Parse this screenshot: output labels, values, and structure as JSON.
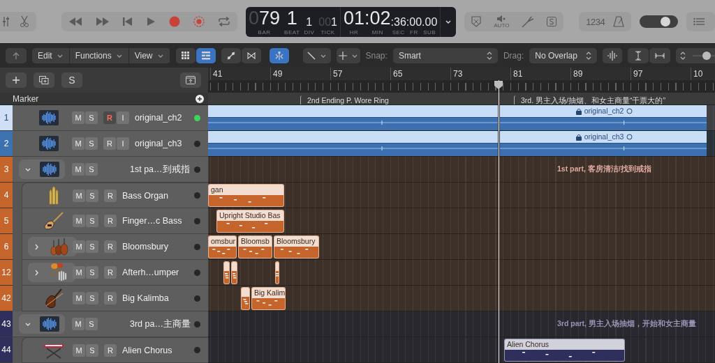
{
  "top_bar": {
    "lcd": {
      "position": [
        {
          "dim": "0",
          "value": "79",
          "label": "BAR",
          "kind": "large"
        },
        {
          "value": "1",
          "label": "BEAT",
          "kind": "large"
        },
        {
          "value": "1",
          "label": "DIV",
          "kind": "small"
        },
        {
          "dim": "00",
          "value": "1",
          "label": "TICK",
          "kind": "small"
        }
      ],
      "time": [
        {
          "value": "01",
          "label": "HR",
          "kind": "large"
        },
        {
          "value": ":02",
          "label": "MIN",
          "kind": "large"
        },
        {
          "value": ":36",
          "label": "SEC",
          "kind": "small"
        },
        {
          "value": ":00",
          "label": "FR",
          "kind": "small"
        },
        {
          "value": ".00",
          "label": "SUB",
          "kind": "small"
        }
      ]
    },
    "auto_label": "AUTO",
    "count_in": "1234",
    "volume": {
      "level": 0.68
    }
  },
  "toolbar": {
    "menus": [
      "Edit",
      "Functions",
      "View"
    ],
    "view_buttons": [
      {
        "selected": false
      },
      {
        "selected": true
      }
    ],
    "tool_buttons": [
      {
        "selected": false
      },
      {
        "selected": false
      },
      {
        "selected": true
      }
    ],
    "snap": {
      "label": "Snap:",
      "value": "Smart"
    },
    "drag": {
      "label": "Drag:",
      "value": "No Overlap"
    },
    "zoom": {
      "level": 0.55
    }
  },
  "track_header": {
    "solo_label": "S",
    "marker_label": "Marker"
  },
  "ruler": {
    "bars": [
      "41",
      "49",
      "57",
      "65",
      "73",
      "81",
      "89",
      "97",
      "10"
    ]
  },
  "markers": [
    {
      "label": "2nd Ending P. Wore Ring"
    },
    {
      "label": "3rd. 男主入场/抽烟、和女主商量“干票大的”"
    }
  ],
  "tracks": [
    {
      "number": "1",
      "name": "original_ch2",
      "kind": "audio",
      "color": "#cfe0f6",
      "buttons": [
        "M",
        "S",
        "R",
        "I"
      ],
      "record_armed": true,
      "active": true,
      "regions": [
        {
          "kind": "audio"
        },
        {
          "kind": "audio",
          "label": "original_ch2"
        }
      ]
    },
    {
      "number": "2",
      "name": "original_ch3",
      "kind": "audio",
      "color": "#3d72b0",
      "buttons": [
        "M",
        "S",
        "R",
        "I"
      ],
      "record_armed": false,
      "active": false,
      "regions": [
        {
          "kind": "audio"
        },
        {
          "kind": "audio",
          "label": "original_ch3"
        }
      ]
    },
    {
      "number": "3",
      "name": "1st pa…到戒指",
      "kind": "folder",
      "color": "#c6652b",
      "buttons": [
        "M",
        "S"
      ],
      "active": false,
      "expanded": true,
      "summary": "1st part, 客房清洁/找到戒指",
      "children": [
        {
          "number": "4",
          "name": "Bass Organ",
          "kind": "instrument",
          "color": "#c6652b",
          "buttons": [
            "M",
            "S",
            "R"
          ],
          "record_armed": false,
          "active": false,
          "regions": [
            {
              "kind": "midi",
              "label": "gan"
            }
          ]
        },
        {
          "number": "5",
          "name": "Finger…c Bass",
          "kind": "instrument",
          "color": "#c6652b",
          "buttons": [
            "M",
            "S",
            "R"
          ],
          "record_armed": false,
          "active": false,
          "regions": [
            {
              "kind": "midi",
              "label": "Upright Studio Bas"
            }
          ]
        },
        {
          "number": "6",
          "name": "Bloomsbury",
          "kind": "instrument",
          "color": "#c6652b",
          "buttons": [
            "M",
            "S",
            "R"
          ],
          "record_armed": false,
          "active": false,
          "expanded": false,
          "regions": [
            {
              "kind": "midi",
              "label": "omsbur"
            },
            {
              "kind": "midi",
              "label": "Bloomsb"
            },
            {
              "kind": "midi",
              "label": "Bloomsbury"
            }
          ]
        },
        {
          "number": "12",
          "name": "Afterh…umper",
          "kind": "instrument",
          "color": "#c6652b",
          "buttons": [
            "M",
            "S",
            "R"
          ],
          "record_armed": false,
          "active": false,
          "expanded": false,
          "regions": [
            {
              "kind": "midi"
            },
            {
              "kind": "midi"
            },
            {
              "kind": "midi"
            }
          ]
        },
        {
          "number": "42",
          "name": "Big Kalimba",
          "kind": "instrument",
          "color": "#c6652b",
          "buttons": [
            "M",
            "S",
            "R"
          ],
          "record_armed": false,
          "active": false,
          "regions": [
            {
              "kind": "midi"
            },
            {
              "kind": "midi",
              "label": "Big Kalim"
            }
          ]
        }
      ]
    },
    {
      "number": "43",
      "name": "3rd pa…主商量",
      "kind": "folder",
      "color": "#2e2f5c",
      "buttons": [
        "M",
        "S"
      ],
      "active": false,
      "expanded": true,
      "summary": "3rd part, 男主入场抽烟，开始和女主商量",
      "children": [
        {
          "number": "44",
          "name": "Alien Chorus",
          "kind": "instrument",
          "color": "#2e2f5c",
          "buttons": [
            "M",
            "S",
            "R"
          ],
          "record_armed": false,
          "active": false,
          "regions": [
            {
              "kind": "midi",
              "label": "Alien Chorus"
            }
          ]
        }
      ]
    }
  ]
}
